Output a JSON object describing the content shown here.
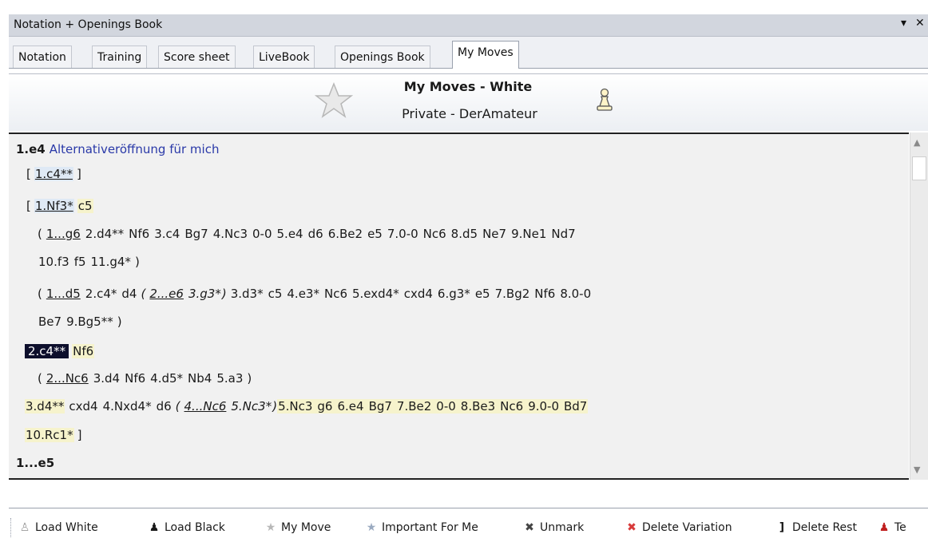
{
  "window": {
    "title": "Notation + Openings Book",
    "menu_glyph": "▾",
    "close_glyph": "✕"
  },
  "tabs": [
    {
      "label": "Notation",
      "active": false
    },
    {
      "label": "Training",
      "active": false
    },
    {
      "label": "Score sheet",
      "active": false
    },
    {
      "label": "LiveBook",
      "active": false
    },
    {
      "label": "Openings Book",
      "active": false
    },
    {
      "label": "My Moves",
      "active": true
    }
  ],
  "header": {
    "title": "My Moves - White",
    "subtitle": "Private - DerAmateur",
    "icons": [
      "star-icon",
      "white-pawn-icon"
    ]
  },
  "notation": {
    "line1": {
      "move": "1.e4",
      "comment": "Alternativeröffnung für mich"
    },
    "line2": {
      "open": "[",
      "move": "1.c4**",
      "close": "]"
    },
    "line3": {
      "open": "[",
      "move": "1.Nf3*",
      "reply": "c5"
    },
    "line4": {
      "open": "(",
      "moves": [
        "1...g6",
        "2.d4**",
        "Nf6",
        "3.c4",
        "Bg7",
        "4.Nc3",
        "0-0",
        "5.e4",
        "d6",
        "6.Be2",
        "e5",
        "7.0-0",
        "Nc6",
        "8.d5",
        "Ne7",
        "9.Ne1",
        "Nd7"
      ]
    },
    "line5": {
      "moves": [
        "10.f3",
        "f5",
        "11.g4*"
      ],
      "close": ")"
    },
    "line6": {
      "open": "(",
      "m1": "1...d5",
      "m2": "2.c4*",
      "m3": "d4",
      "sub_open": "(",
      "sub1": "2...e6",
      "sub2": "3.g3*",
      "sub_close": ")",
      "rest": [
        "3.d3*",
        "c5",
        "4.e3*",
        "Nc6",
        "5.exd4*",
        "cxd4",
        "6.g3*",
        "e5",
        "7.Bg2",
        "Nf6",
        "8.0-0"
      ]
    },
    "line7": {
      "moves": [
        "Be7",
        "9.Bg5**"
      ],
      "close": ")"
    },
    "line8": {
      "current_move": "2.c4**",
      "reply": "Nf6"
    },
    "line9": {
      "open": "(",
      "m1": "2...Nc6",
      "moves": [
        "3.d4",
        "Nf6",
        "4.d5*",
        "Nb4",
        "5.a3"
      ],
      "close": ")"
    },
    "line10": {
      "pre": [
        "3.d4**",
        "cxd4",
        "4.Nxd4*",
        "d6"
      ],
      "sub_open": "(",
      "sub1": "4...Nc6",
      "sub2": "5.Nc3*",
      "sub_close": ")",
      "post": [
        "5.Nc3",
        "g6",
        "6.e4",
        "Bg7",
        "7.Be2",
        "0-0",
        "8.Be3",
        "Nc6",
        "9.0-0",
        "Bd7"
      ]
    },
    "line11": {
      "move": "10.Rc1*",
      "close": "]"
    },
    "line12": {
      "move": "1...e5"
    }
  },
  "toolbar": {
    "buttons": [
      {
        "label": "Load White",
        "icon": "white-pawn-icon"
      },
      {
        "label": "Load Black",
        "icon": "black-pawn-icon"
      },
      {
        "label": "My Move",
        "icon": "star-icon"
      },
      {
        "label": "Important For Me",
        "icon": "star-plus-icon"
      },
      {
        "label": "Unmark",
        "icon": "unmark-icon"
      },
      {
        "label": "Delete Variation",
        "icon": "delete-icon"
      },
      {
        "label": "Delete Rest",
        "icon": "bracket-icon"
      },
      {
        "label": "Te",
        "icon": "red-pawn-icon"
      }
    ]
  },
  "colors": {
    "selected_move_bg": "#0d0f2c",
    "comment_text": "#2a39a8",
    "main_highlight": "#f6f3cc",
    "branch_highlight": "#dfe9f5"
  }
}
